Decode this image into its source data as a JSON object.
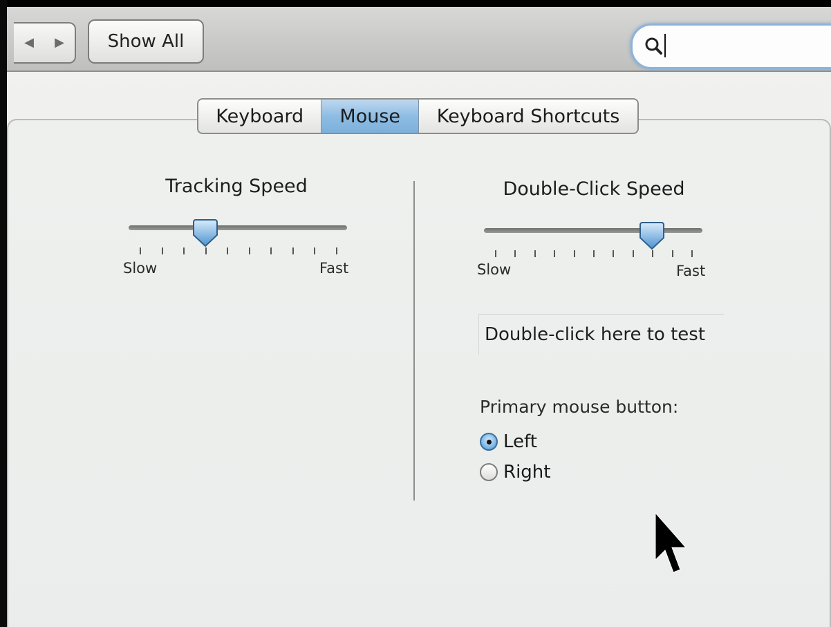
{
  "toolbar": {
    "back_glyph": "◀",
    "forward_glyph": "▶",
    "show_all_label": "Show All",
    "search_placeholder": "",
    "search_icon": "search-icon"
  },
  "tabs": [
    {
      "label": "Keyboard",
      "selected": false
    },
    {
      "label": "Mouse",
      "selected": true
    },
    {
      "label": "Keyboard Shortcuts",
      "selected": false
    }
  ],
  "tracking": {
    "title": "Tracking Speed",
    "min_label": "Slow",
    "max_label": "Fast",
    "tick_count": 10,
    "value_tick": 3
  },
  "double_click": {
    "title": "Double-Click Speed",
    "min_label": "Slow",
    "max_label": "Fast",
    "tick_count": 11,
    "value_tick": 8,
    "test_area_text": "Double-click here to test"
  },
  "primary_button": {
    "label": "Primary mouse button:",
    "options": [
      {
        "label": "Left",
        "selected": true
      },
      {
        "label": "Right",
        "selected": false
      }
    ]
  },
  "colors": {
    "selected_tab": "#8ebde3",
    "accent": "#4f8fc6",
    "search_focus": "#8fb3d6"
  }
}
